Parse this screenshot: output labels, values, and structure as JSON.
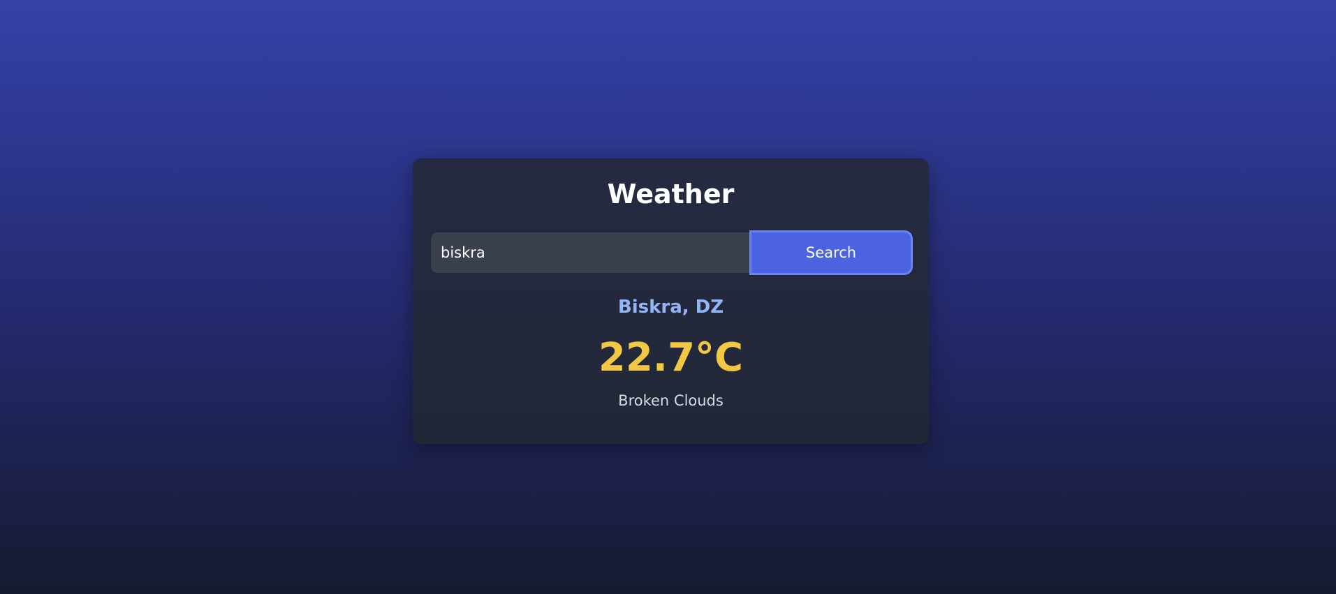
{
  "app": {
    "title": "Weather"
  },
  "search": {
    "value": "biskra",
    "button_label": "Search"
  },
  "result": {
    "location": "Biskra, DZ",
    "temperature": "22.7°C",
    "condition": "Broken Clouds"
  },
  "colors": {
    "accent": "#4b63e0",
    "location_text": "#93b4f5",
    "temperature_text": "#f2c744",
    "card_background": "#232839"
  }
}
